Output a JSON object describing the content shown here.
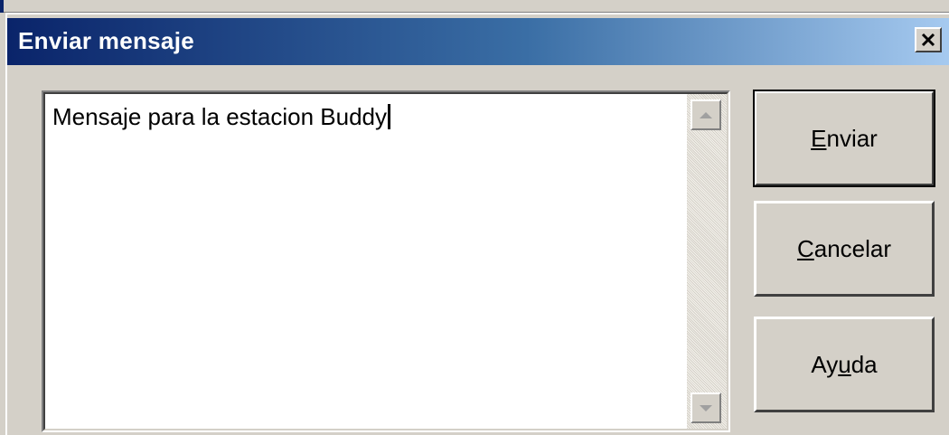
{
  "window": {
    "title": "Enviar mensaje",
    "close_glyph": "✕"
  },
  "message": {
    "text": "Mensaje para la estacion Buddy"
  },
  "buttons": {
    "send": {
      "before": "",
      "underlined": "E",
      "after": "nviar"
    },
    "cancel": {
      "before": "",
      "underlined": "C",
      "after": "ancelar"
    },
    "help": {
      "before": "Ay",
      "underlined": "u",
      "after": "da"
    }
  },
  "colors": {
    "titlebar_start": "#0a246a",
    "titlebar_end": "#a6caf0",
    "face": "#d4d0c8"
  },
  "icons": {
    "close": "close-icon",
    "scroll_up": "arrow-up-icon",
    "scroll_down": "arrow-down-icon"
  }
}
